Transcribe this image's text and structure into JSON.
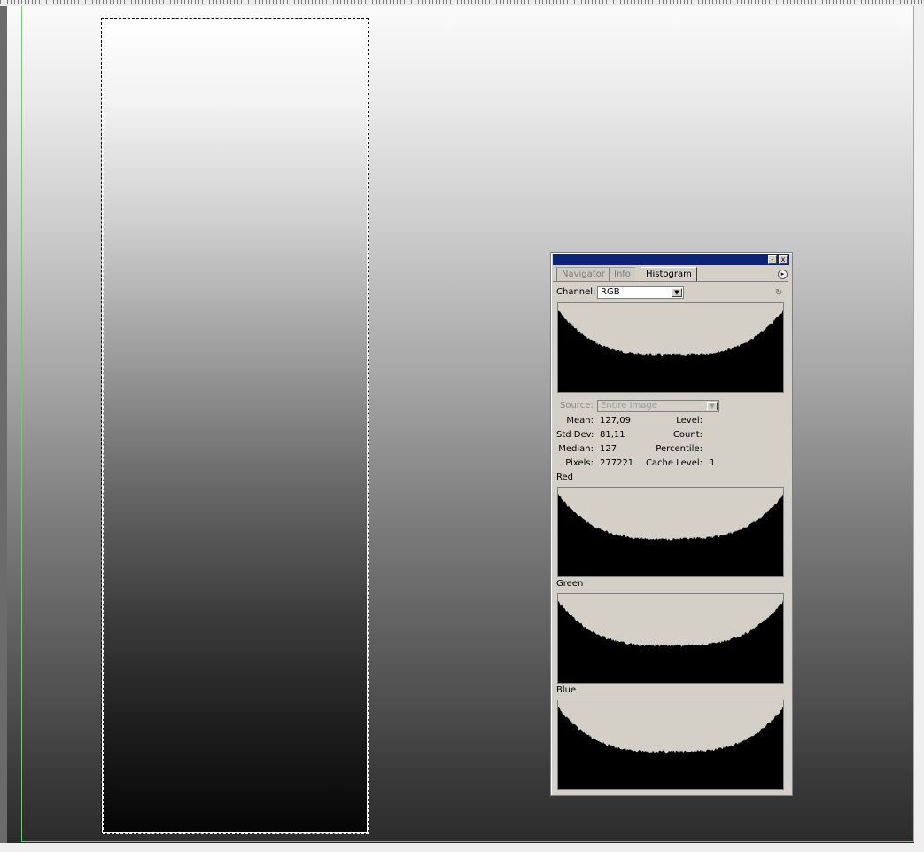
{
  "palette": {
    "tabs": [
      "Navigator",
      "Info",
      "Histogram"
    ],
    "active_tab": "Histogram",
    "title_buttons": {
      "minimize": "-",
      "close": "x"
    },
    "menu_icon": "▸",
    "channel_label": "Channel:",
    "channel_value": "RGB",
    "source_label": "Source:",
    "source_value": "Entire Image",
    "stats": {
      "mean_label": "Mean:",
      "mean_value": "127,09",
      "stddev_label": "Std Dev:",
      "stddev_value": "81,11",
      "median_label": "Median:",
      "median_value": "127",
      "pixels_label": "Pixels:",
      "pixels_value": "277221",
      "level_label": "Level:",
      "level_value": "",
      "count_label": "Count:",
      "count_value": "",
      "percentile_label": "Percentile:",
      "percentile_value": "",
      "cache_label": "Cache Level:",
      "cache_value": "1"
    },
    "channels": [
      "Red",
      "Green",
      "Blue"
    ],
    "colors": {
      "title_bar": "#0b2473",
      "panel": "#d4d0c8",
      "hist_fill": "#000000"
    }
  }
}
